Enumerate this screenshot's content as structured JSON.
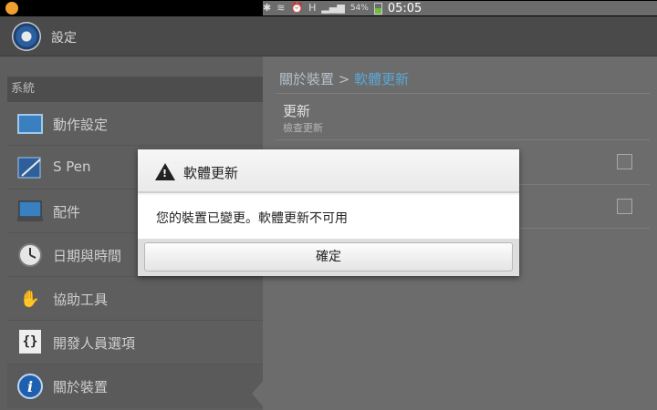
{
  "status_bar": {
    "battery_percent": "54%",
    "battery_level": 0.54,
    "time": "05:05",
    "icons": [
      "bluetooth-icon",
      "vibrate-icon",
      "alarm-icon",
      "hplus-data-icon",
      "signal-icon",
      "battery-icon"
    ]
  },
  "action_bar": {
    "title": "設定",
    "icon": "settings-gear-icon"
  },
  "sidebar": {
    "section": "系統",
    "items": [
      {
        "label": "動作設定",
        "icon": "motion-icon"
      },
      {
        "label": "S Pen",
        "icon": "spen-icon"
      },
      {
        "label": "配件",
        "icon": "accessory-icon"
      },
      {
        "label": "日期與時間",
        "icon": "clock-icon"
      },
      {
        "label": "協助工具",
        "icon": "hand-icon"
      },
      {
        "label": "開發人員選項",
        "icon": "developer-braces-icon"
      },
      {
        "label": "關於裝置",
        "icon": "info-icon",
        "selected": true
      }
    ]
  },
  "detail": {
    "breadcrumb_parent": "關於裝置",
    "breadcrumb_separator": ">",
    "breadcrumb_current": "軟體更新",
    "update_title": "更新",
    "update_subtitle": "檢查更新"
  },
  "dialog": {
    "title": "軟體更新",
    "message": "您的裝置已變更。軟體更新不可用",
    "ok_label": "確定"
  },
  "colors": {
    "accent": "#5aa7d4",
    "dialog_bg": "#f4f4f4"
  }
}
